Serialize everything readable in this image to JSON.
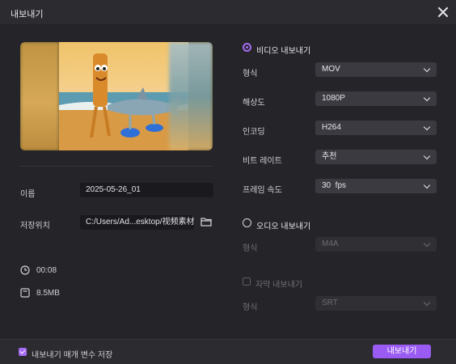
{
  "window": {
    "title": "내보내기"
  },
  "left": {
    "name_label": "이름",
    "name_value": "2025-05-26_01",
    "save_label": "저장위치",
    "save_path": "C:/Users/Ad...esktop/视频素材",
    "duration": "00:08",
    "size": "8.5MB"
  },
  "video": {
    "section": "비디오 내보내기",
    "rows": [
      {
        "label": "형식",
        "value": "MOV"
      },
      {
        "label": "해상도",
        "value": "1080P"
      },
      {
        "label": "인코딩",
        "value": "H264"
      },
      {
        "label": "비트 레이트",
        "value": "추천"
      },
      {
        "label": "프레임 속도",
        "value": "30  fps"
      }
    ]
  },
  "audio": {
    "section": "오디오 내보내기",
    "format_label": "형식",
    "format_value": "M4A"
  },
  "subtitle": {
    "checkbox_label": "자막 내보내기",
    "format_label": "형식",
    "format_value": "SRT"
  },
  "footer": {
    "save_params_label": "내보내기 매개 변수 저장",
    "export_label": "내보내기"
  },
  "colors": {
    "accent": "#9a5bf2",
    "background": "#252529"
  }
}
